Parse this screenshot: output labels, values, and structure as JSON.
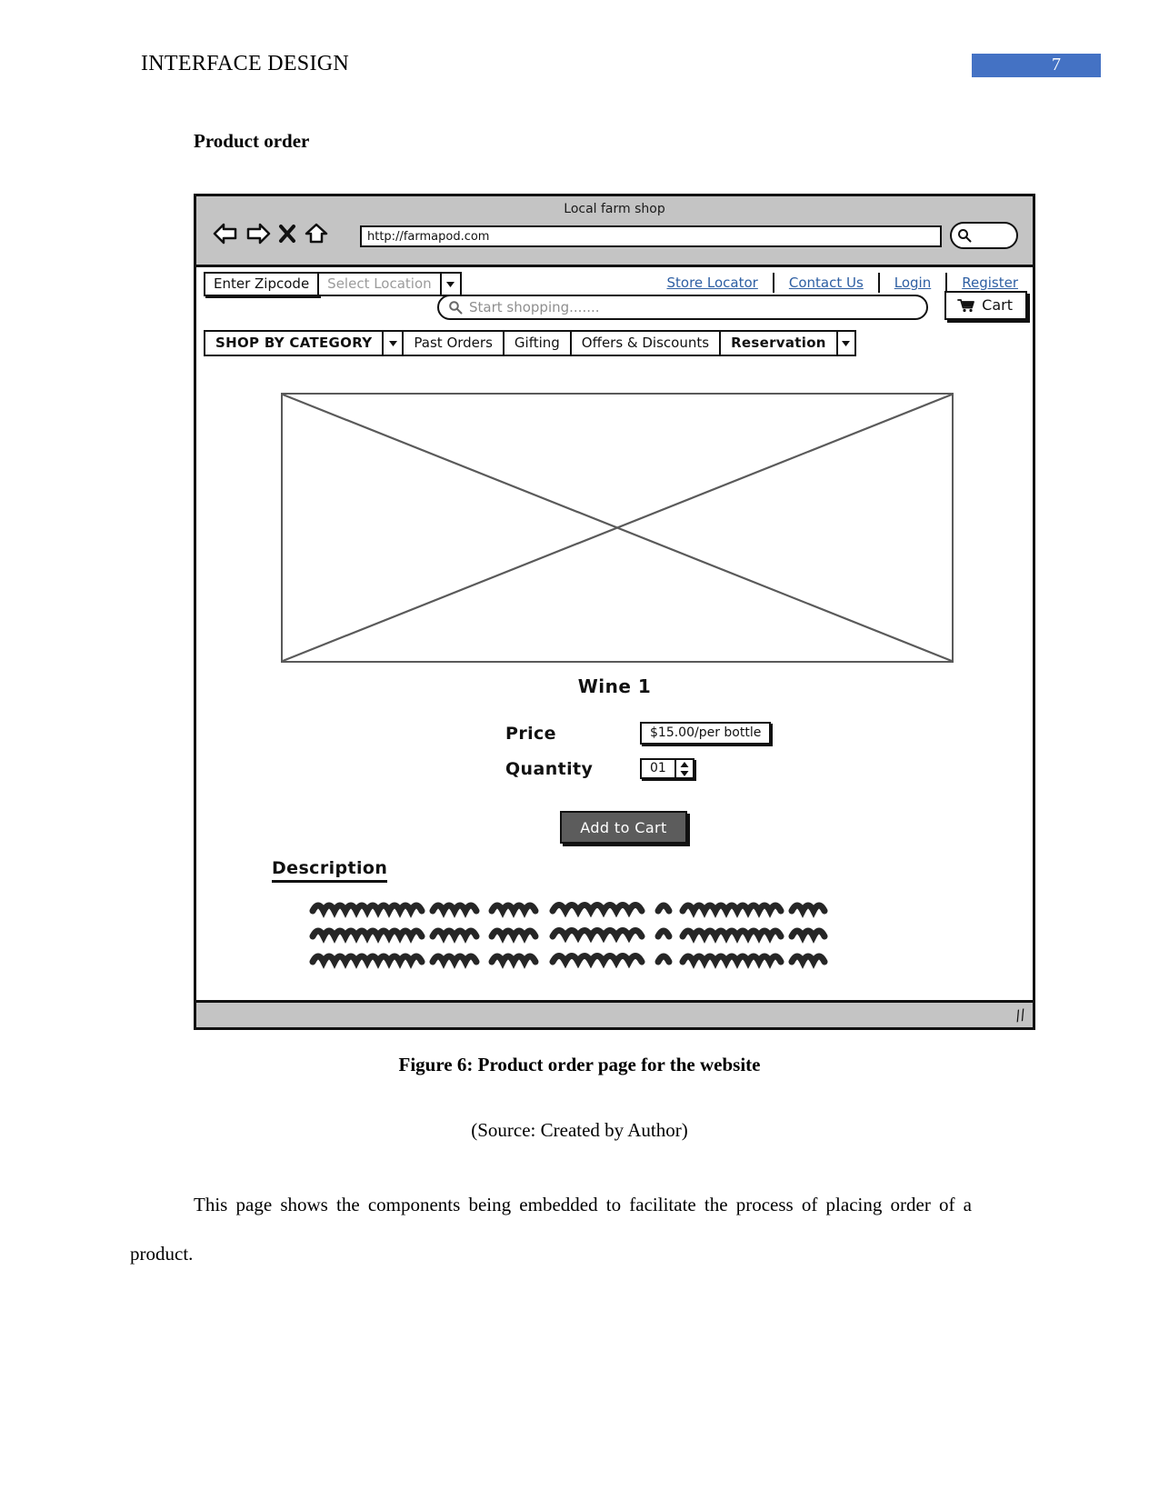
{
  "document": {
    "running_header": "INTERFACE DESIGN",
    "page_number": "7",
    "page_number_bg": "#4472C4",
    "section_heading": "Product order",
    "figure_caption": "Figure 6: Product order page for the website",
    "source_line": "(Source: Created by Author)",
    "body_paragraph": "This page shows the components being embedded to facilitate the process of placing order of a product."
  },
  "wireframe": {
    "browser": {
      "window_title": "Local farm shop",
      "url_value": "http://farmapod.com",
      "nav_icons": [
        "back-arrow-icon",
        "forward-arrow-icon",
        "stop-x-icon",
        "home-icon"
      ],
      "chrome_search_icon": "search-icon"
    },
    "utility_bar": {
      "zipcode_button": "Enter Zipcode",
      "location_select_value": "Select Location",
      "location_caret_icon": "chevron-down-icon",
      "links": [
        "Store Locator",
        "Contact Us",
        "Login",
        "Register"
      ],
      "search_placeholder": "Start shopping.......",
      "search_icon": "search-icon",
      "cart_label": "Cart",
      "cart_icon": "shopping-cart-icon"
    },
    "category_nav": {
      "items": [
        {
          "label": "SHOP BY CATEGORY",
          "has_caret": true
        },
        {
          "label": "Past Orders",
          "has_caret": false
        },
        {
          "label": "Gifting",
          "has_caret": false
        },
        {
          "label": "Offers & Discounts",
          "has_caret": false
        },
        {
          "label": "Reservation",
          "has_caret": true
        }
      ]
    },
    "product": {
      "image_placeholder": "crossed-box-image-placeholder",
      "title": "Wine 1",
      "price_label": "Price",
      "price_value": "$15.00/per bottle",
      "quantity_label": "Quantity",
      "quantity_value": "01",
      "quantity_stepper_icon": "spinner-up-down-icon",
      "add_to_cart_label": "Add to Cart",
      "add_to_cart_bg": "#5c5c5c"
    },
    "description": {
      "heading": "Description",
      "placeholder_lines": 3
    },
    "status_bar": {
      "resize_grip_icon": "resize-grip-icon"
    }
  }
}
